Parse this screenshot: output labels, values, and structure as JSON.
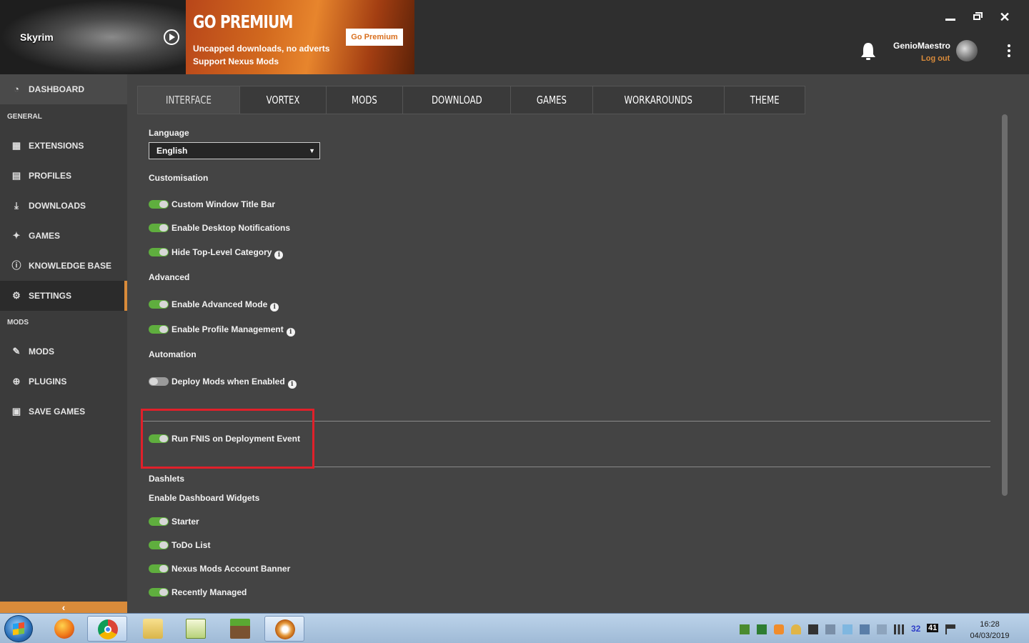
{
  "header": {
    "game_name": "Skyrim",
    "premium_title": "GO PREMIUM",
    "premium_line1": "Uncapped downloads, no adverts",
    "premium_line2": "Support Nexus Mods",
    "premium_button": "Go Premium",
    "username": "GenioMaestro",
    "logout": "Log out"
  },
  "sidebar": {
    "dashboard": "DASHBOARD",
    "general_heading": "GENERAL",
    "general_items": [
      "EXTENSIONS",
      "PROFILES",
      "DOWNLOADS",
      "GAMES",
      "KNOWLEDGE BASE",
      "SETTINGS"
    ],
    "mods_heading": "MODS",
    "mods_items": [
      "MODS",
      "PLUGINS",
      "SAVE GAMES"
    ]
  },
  "tabs": [
    "INTERFACE",
    "VORTEX",
    "MODS",
    "DOWNLOAD",
    "GAMES",
    "WORKAROUNDS",
    "THEME"
  ],
  "settings": {
    "language_label": "Language",
    "language_value": "English",
    "customisation_heading": "Customisation",
    "customisation": [
      {
        "label": "Custom Window Title Bar",
        "on": true
      },
      {
        "label": "Enable Desktop Notifications",
        "on": true
      },
      {
        "label": "Hide Top-Level Category",
        "on": true
      }
    ],
    "advanced_heading": "Advanced",
    "advanced": [
      {
        "label": "Enable Advanced Mode",
        "on": true
      },
      {
        "label": "Enable Profile Management",
        "on": true
      }
    ],
    "automation_heading": "Automation",
    "automation": [
      {
        "label": "Deploy Mods when Enabled",
        "on": false
      }
    ],
    "fnis": {
      "label": "Run FNIS on Deployment Event",
      "on": true
    },
    "dashlets_heading": "Dashlets",
    "dashlets_sub": "Enable Dashboard Widgets",
    "dashlets": [
      {
        "label": "Starter",
        "on": true
      },
      {
        "label": "ToDo List",
        "on": true
      },
      {
        "label": "Nexus Mods Account Banner",
        "on": true
      },
      {
        "label": "Recently Managed",
        "on": true
      }
    ]
  },
  "taskbar": {
    "time": "16:28",
    "date": "04/03/2019",
    "tray_numbers": [
      "32",
      "41"
    ]
  },
  "colors": {
    "accent": "#d98b3a",
    "toggle_on": "#5fae3e",
    "highlight": "#e0202a"
  }
}
